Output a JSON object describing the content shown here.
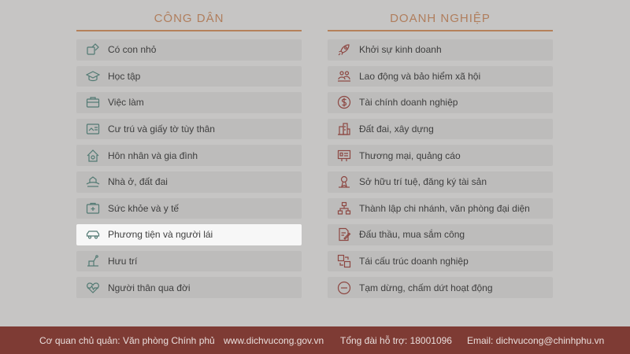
{
  "citizen": {
    "title": "CÔNG DÂN",
    "items": [
      {
        "label": "Có con nhỏ",
        "icon": "baby-icon"
      },
      {
        "label": "Học tập",
        "icon": "graduation-cap-icon"
      },
      {
        "label": "Việc làm",
        "icon": "briefcase-icon"
      },
      {
        "label": "Cư trú và giấy tờ tùy thân",
        "icon": "id-card-icon"
      },
      {
        "label": "Hôn nhân và gia đình",
        "icon": "family-home-icon"
      },
      {
        "label": "Nhà ở, đất đai",
        "icon": "house-land-icon"
      },
      {
        "label": "Sức khỏe và y tế",
        "icon": "medical-kit-icon"
      },
      {
        "label": "Phương tiện và người lái",
        "icon": "car-icon"
      },
      {
        "label": "Hưu trí",
        "icon": "retirement-icon"
      },
      {
        "label": "Người thân qua đời",
        "icon": "heart-icon"
      }
    ],
    "active_index": 7
  },
  "business": {
    "title": "DOANH NGHIỆP",
    "items": [
      {
        "label": "Khởi sự kinh doanh",
        "icon": "rocket-icon"
      },
      {
        "label": "Lao động và bảo hiểm xã hội",
        "icon": "workers-icon"
      },
      {
        "label": "Tài chính doanh nghiệp",
        "icon": "dollar-icon"
      },
      {
        "label": "Đất đai, xây dựng",
        "icon": "buildings-icon"
      },
      {
        "label": "Thương mại, quảng cáo",
        "icon": "billboard-icon"
      },
      {
        "label": "Sở hữu trí tuệ, đăng ký tài sản",
        "icon": "ip-icon"
      },
      {
        "label": "Thành lập chi nhánh, văn phòng đại diện",
        "icon": "org-chart-icon"
      },
      {
        "label": "Đấu thầu, mua sắm công",
        "icon": "document-pen-icon"
      },
      {
        "label": "Tái cấu trúc doanh nghiệp",
        "icon": "restructure-icon"
      },
      {
        "label": "Tạm dừng, chấm dứt hoạt động",
        "icon": "stop-icon"
      }
    ]
  },
  "footer": {
    "agency": "Cơ quan chủ quản: Văn phòng Chính phủ",
    "website": "www.dichvucong.gov.vn",
    "hotline": "Tổng đài hỗ trợ: 18001096",
    "email": "Email: dichvucong@chinhphu.vn"
  },
  "colors": {
    "background": "#c6c5c4",
    "accent": "#b5815b",
    "footer": "#7e3b34",
    "citizen_icon": "#527a73",
    "business_icon": "#8d4742"
  }
}
